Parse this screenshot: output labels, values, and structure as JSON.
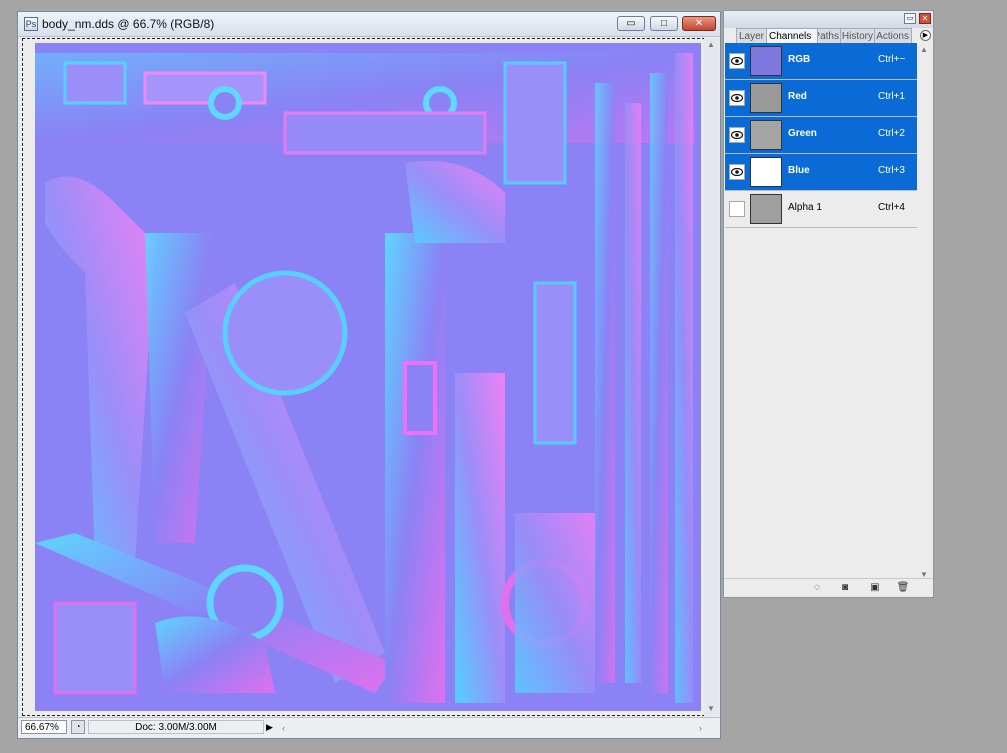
{
  "document": {
    "title": "body_nm.dds @ 66.7% (RGB/8)",
    "title_buttons": {
      "minimize": "▭",
      "maximize": "□",
      "close": "✕"
    },
    "zoom": "66.67%",
    "doc_size": "Doc: 3.00M/3.00M",
    "canvas_color": "#8a82f5"
  },
  "palette": {
    "tabs": [
      "Layer",
      "Channels",
      "Paths",
      "History",
      "Actions"
    ],
    "active_tab": "Channels",
    "channels": [
      {
        "name": "RGB",
        "shortcut": "Ctrl+~",
        "visible": true,
        "selected": true,
        "thumb": "#7c78e0"
      },
      {
        "name": "Red",
        "shortcut": "Ctrl+1",
        "visible": true,
        "selected": true,
        "thumb": "#9a9a9a"
      },
      {
        "name": "Green",
        "shortcut": "Ctrl+2",
        "visible": true,
        "selected": true,
        "thumb": "#a5a5a5"
      },
      {
        "name": "Blue",
        "shortcut": "Ctrl+3",
        "visible": true,
        "selected": true,
        "thumb": "#ffffff"
      },
      {
        "name": "Alpha 1",
        "shortcut": "Ctrl+4",
        "visible": false,
        "selected": false,
        "thumb": "#9f9f9f"
      }
    ],
    "footer_icons": [
      "load-selection-icon",
      "save-selection-icon",
      "new-channel-icon",
      "delete-channel-icon"
    ]
  },
  "colors": {
    "selection": "#0a6ad6",
    "background": "#a5a5a5"
  }
}
